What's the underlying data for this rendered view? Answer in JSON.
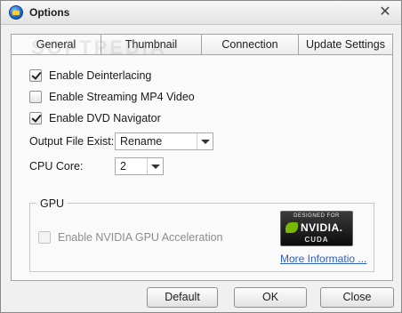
{
  "window": {
    "title": "Options"
  },
  "tabs": [
    {
      "label": "General",
      "active": true
    },
    {
      "label": "Thumbnail",
      "active": false
    },
    {
      "label": "Connection",
      "active": false
    },
    {
      "label": "Update Settings",
      "active": false
    }
  ],
  "watermark": "SOFTPEDIA",
  "options": {
    "deinterlacing": {
      "label": "Enable Deinterlacing",
      "checked": true
    },
    "streaming_mp4": {
      "label": "Enable Streaming MP4 Video",
      "checked": false
    },
    "dvd_navigator": {
      "label": "Enable DVD Navigator",
      "checked": true
    }
  },
  "output_file_exist": {
    "label": "Output File Exist:",
    "value": "Rename"
  },
  "cpu_core": {
    "label": "CPU Core:",
    "value": "2"
  },
  "gpu": {
    "group_title": "GPU",
    "nvidia_accel": {
      "label": "Enable NVIDIA GPU Acceleration",
      "checked": false,
      "enabled": false
    },
    "badge": {
      "top_text": "DESIGNED FOR",
      "name": "NVIDIA.",
      "bottom_text": "CUDA"
    },
    "more_info": "More Informatio ..."
  },
  "buttons": {
    "default": "Default",
    "ok": "OK",
    "close": "Close"
  },
  "colors": {
    "link": "#2c5fc5",
    "nvidia_green": "#76b900"
  }
}
